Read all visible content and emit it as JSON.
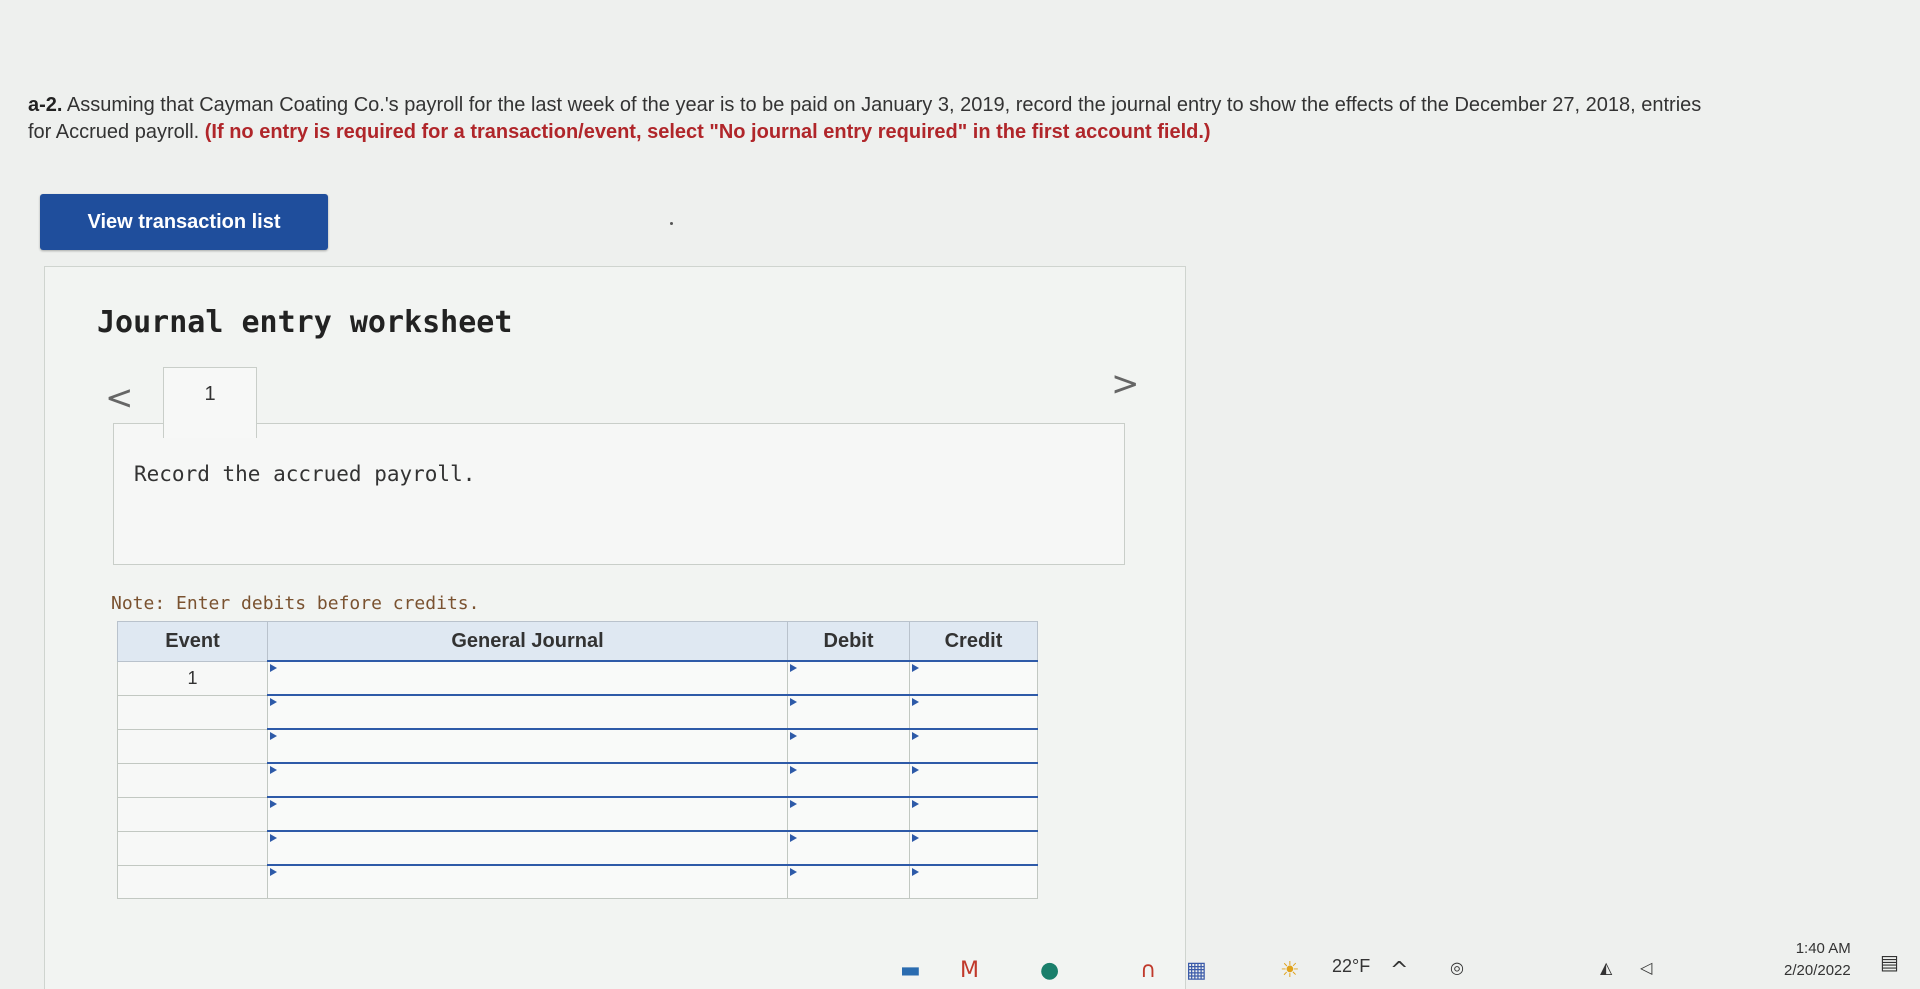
{
  "question": {
    "label": "a-2.",
    "text": "Assuming that Cayman Coating Co.'s payroll for the last week of the year is to be paid on January 3, 2019, record the journal entry to show the effects of the December 27, 2018, entries",
    "text2": "for Accrued payroll.",
    "instruction": "(If no entry is required for a transaction/event, select \"No journal entry required\" in the first account field.)"
  },
  "view_button": "View transaction list",
  "worksheet": {
    "title": "Journal entry worksheet",
    "prev": "<",
    "next": ">",
    "tab": "1",
    "description": "Record the accrued payroll.",
    "note": "Note: Enter debits before credits."
  },
  "table": {
    "headers": {
      "event": "Event",
      "general_journal": "General Journal",
      "debit": "Debit",
      "credit": "Credit"
    },
    "rows": [
      {
        "event": "1",
        "account": "",
        "debit": "",
        "credit": ""
      },
      {
        "event": "",
        "account": "",
        "debit": "",
        "credit": ""
      },
      {
        "event": "",
        "account": "",
        "debit": "",
        "credit": ""
      },
      {
        "event": "",
        "account": "",
        "debit": "",
        "credit": ""
      },
      {
        "event": "",
        "account": "",
        "debit": "",
        "credit": ""
      },
      {
        "event": "",
        "account": "",
        "debit": "",
        "credit": ""
      },
      {
        "event": "",
        "account": "",
        "debit": "",
        "credit": ""
      }
    ]
  },
  "taskbar": {
    "temperature": "22°F",
    "time": "1:40 AM",
    "date": "2/20/2022"
  }
}
